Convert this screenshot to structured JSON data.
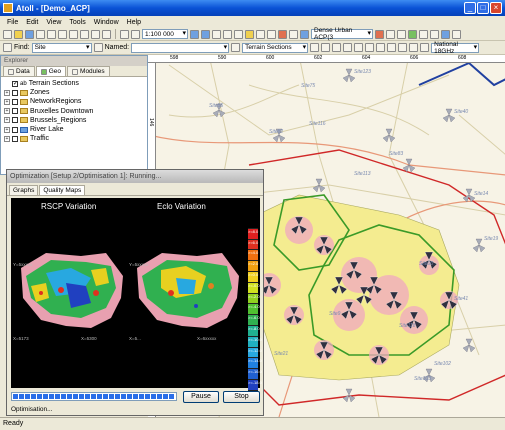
{
  "window": {
    "title": "Atoll - [Demo_ACP]",
    "minimize": "_",
    "maximize": "□",
    "close": "×"
  },
  "menu": [
    "File",
    "Edit",
    "View",
    "Tools",
    "Window",
    "Help"
  ],
  "toolbar1": {
    "zoom_value": "1:100 000",
    "zone_value": "Dense Urban ACP(3",
    "band_value": "National 18GHz"
  },
  "toolbar2": {
    "find_label": "Find:",
    "find_value": "Site",
    "named_label": "Named:",
    "named_value": "",
    "layer_value": "Terrain Sections"
  },
  "explorer": {
    "title": "Explorer",
    "tabs": [
      "Data",
      "Geo",
      "Modules"
    ],
    "active_tab": "Geo",
    "items": [
      {
        "label": "Terrain Sections",
        "checked": true,
        "expandable": false
      },
      {
        "label": "Zones",
        "checked": false,
        "expandable": true
      },
      {
        "label": "NetworkRegions",
        "checked": false,
        "expandable": true
      },
      {
        "label": "Bruxelles Downtown",
        "checked": false,
        "expandable": true
      },
      {
        "label": "Brussels_Regions",
        "checked": false,
        "expandable": true
      },
      {
        "label": "River Lake",
        "checked": false,
        "expandable": true
      },
      {
        "label": "Traffic",
        "checked": false,
        "expandable": true
      }
    ]
  },
  "map": {
    "ruler_top": [
      "598",
      "590",
      "600",
      "602",
      "604",
      "606",
      "608"
    ],
    "ruler_left": [
      "146"
    ],
    "site_labels": [
      "Site123",
      "Site75",
      "Site56",
      "Site82",
      "Site40",
      "Site116",
      "Site113",
      "Site14",
      "Site83",
      "Site19",
      "Site90",
      "Site41",
      "Site9",
      "Site118",
      "Site21",
      "Site103",
      "Site102"
    ]
  },
  "dialog": {
    "title": "Optimization [Setup 2/Optimisation 1]: Running...",
    "tabs": [
      "Graphs",
      "Quality Maps"
    ],
    "active_tab": "Quality Maps",
    "left_plot_title": "RSCP Variation",
    "right_plot_title": "Eclo Variation",
    "coord_labels": [
      "Y=5xxxxx",
      "Y=5xxxxx",
      "X=5173",
      "X=5300",
      "X=5...",
      "X=6xxxxx"
    ],
    "scale_labels": [
      "",
      ">=8.0",
      ">=6.0",
      ">=4.0",
      ">=2.0",
      ">=0.0",
      ">=-0.0",
      ">=-2.0",
      ">=-4.0",
      ">=-6.0",
      ">=-8.0",
      ">=-10.0",
      ">=-12.0",
      ">=-14.0",
      ">=-16.0",
      ">=-18.0",
      ">-20.0"
    ],
    "progress_blocks": 27,
    "pause_label": "Pause",
    "stop_label": "Stop",
    "status": "Optimisation..."
  },
  "status_bar": {
    "text": "Ready"
  }
}
